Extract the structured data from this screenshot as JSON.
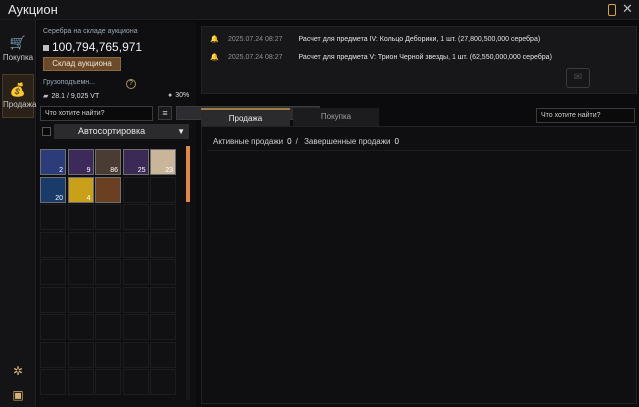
{
  "window": {
    "title": "Аукцион",
    "pin_icon": "pin-icon",
    "close_icon": "close-icon"
  },
  "sidebar": {
    "items": [
      {
        "label": "Покупка",
        "icon": "cart-icon",
        "active": false
      },
      {
        "label": "Продажа",
        "icon": "moneybag-icon",
        "active": true
      }
    ],
    "bottom_icons": [
      "tree-icon",
      "chest-icon"
    ]
  },
  "warehouse": {
    "silver_label": "Серебра на складе аукциона",
    "silver_amount": "100,794,765,971",
    "button_label": "Склад аукциона",
    "weight_label": "Грузоподъемн...",
    "weight_value": "28.1 / 9,025 VT",
    "weight_percent": "30%",
    "help_label": "?"
  },
  "inventory": {
    "search_placeholder": "Что хотите найти?",
    "autosort_label": "Автосортировка",
    "items": [
      {
        "count": "2",
        "color": "#2a3d7a"
      },
      {
        "count": "9",
        "color": "#3c2a5a"
      },
      {
        "count": "86",
        "color": "#4a3b33"
      },
      {
        "count": "25",
        "color": "#3a2a55"
      },
      {
        "count": "23",
        "color": "#c8b59a"
      },
      {
        "count": "20",
        "color": "#1a3a6a"
      },
      {
        "count": "4",
        "color": "#c8a01a"
      },
      {
        "count": "",
        "color": "#6a3f22"
      }
    ]
  },
  "notifications": [
    {
      "date": "2025.07.24 08:27",
      "text": "Расчет для предмета IV: Кольцо Деборики, 1 шт. (27,800,500,000 серебра)"
    },
    {
      "date": "2025.07.24 08:27",
      "text": "Расчет для предмета V: Трион Черной звезды, 1 шт. (62,550,000,000 серебра)"
    }
  ],
  "tabs": {
    "sell": "Продажа",
    "buy": "Покупка"
  },
  "market": {
    "search_placeholder": "Что хотите найти?",
    "active_label": "Активные продажи",
    "active_count": "0",
    "completed_label": "Завершенные продажи",
    "completed_count": "0",
    "separator": "/"
  }
}
